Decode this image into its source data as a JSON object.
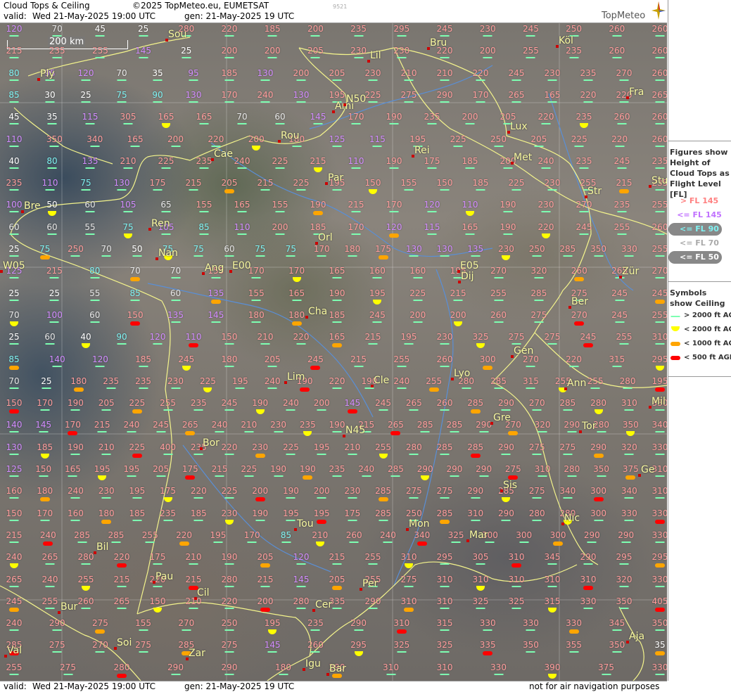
{
  "header": {
    "title": "Cloud Tops & Ceiling",
    "copyright": "©2025 TopMeteo.eu, EUMETSAT",
    "image_id": "9521",
    "valid_label": "valid:",
    "valid_time": "Wed  21-May-2025  19:00 UTC",
    "gen_time": "gen: 21-May-2025 19 UTC",
    "logo": "TopMeteo"
  },
  "footer": {
    "valid_label": "valid:",
    "valid_time": "Wed  21-May-2025  19:00 UTC",
    "gen_time": "gen: 21-May-2025 19 UTC",
    "disclaimer": "not for air navigation purposes"
  },
  "scale": "200 km",
  "legend": {
    "fl_title": "Figures show Height of Cloud Tops as Flight Level  [FL]",
    "fl_items": [
      "> FL 145",
      "<= FL 145",
      "<= FL 90",
      "<= FL 70",
      "<= FL 50"
    ],
    "sym_title": "Symbols show Ceiling",
    "sym_items": [
      "> 2000 ft AGL",
      "< 2000 ft AGL",
      "< 1000 ft AGL",
      "< 500 ft AGL"
    ]
  },
  "cities": [
    "Sou",
    "Ply",
    "Köl",
    "Bru",
    "Lil",
    "Fra",
    "Ami",
    "N50",
    "Lux",
    "Rou",
    "Cae",
    "Rei",
    "Met",
    "Par",
    "Stu",
    "Str",
    "Bre",
    "Ren",
    "Orl",
    "Ang",
    "E00",
    "W05",
    "Nan",
    "Zür",
    "E05",
    "Dij",
    "Ber",
    "Cha",
    "Gen",
    "Lim",
    "Cle",
    "Lyo",
    "Ann",
    "Mil",
    "Bor",
    "N45",
    "Gre",
    "Tor",
    "Ge",
    "Sis",
    "Nic",
    "Tou",
    "Mon",
    "Mar",
    "Bil",
    "Pau",
    "Cil",
    "Per",
    "Bur",
    "Cer",
    "Soi",
    "Aja",
    "Val",
    "Zar",
    "Igu",
    "Bar"
  ],
  "cloud_tops": [
    [
      "120",
      "70",
      "45",
      "25",
      "280",
      "220",
      "185",
      "200",
      "235",
      "295",
      "245",
      "230",
      "245",
      "250",
      "260",
      "260"
    ],
    [
      "215",
      "235",
      "255",
      "145",
      "25",
      "200",
      "200",
      "205",
      "230",
      "230",
      "220",
      "200",
      "255",
      "235",
      "260",
      "260"
    ],
    [
      "80",
      "95",
      "120",
      "70",
      "35",
      "95",
      "185",
      "130",
      "200",
      "205",
      "230",
      "210",
      "210",
      "220",
      "245",
      "230",
      "235",
      "270",
      "260"
    ],
    [
      "85",
      "30",
      "25",
      "75",
      "90",
      "130",
      "170",
      "240",
      "130",
      "195",
      "225",
      "275",
      "290",
      "170",
      "265",
      "165",
      "220",
      "220",
      "265"
    ],
    [
      "45",
      "35",
      "115",
      "305",
      "165",
      "165",
      "70",
      "60",
      "145",
      "170",
      "190",
      "235",
      "200",
      "205",
      "220",
      "235",
      "260",
      "260"
    ],
    [
      "110",
      "350",
      "340",
      "165",
      "200",
      "220",
      "200",
      "180",
      "125",
      "115",
      "195",
      "225",
      "250",
      "205",
      "225",
      "220",
      "260"
    ],
    [
      "40",
      "80",
      "135",
      "210",
      "225",
      "235",
      "240",
      "225",
      "215",
      "110",
      "190",
      "175",
      "185",
      "200",
      "240",
      "235",
      "245",
      "235"
    ],
    [
      "235",
      "110",
      "75",
      "130",
      "175",
      "215",
      "205",
      "215",
      "225",
      "195",
      "150",
      "155",
      "150",
      "185",
      "225",
      "230",
      "255",
      "215",
      "235"
    ],
    [
      "100",
      "50",
      "60",
      "105",
      "65",
      "155",
      "165",
      "155",
      "190",
      "215",
      "170",
      "120",
      "110",
      "190",
      "230",
      "270",
      "235",
      "255"
    ],
    [
      "60",
      "60",
      "55",
      "75",
      "105",
      "85",
      "110",
      "200",
      "185",
      "170",
      "120",
      "115",
      "165",
      "190",
      "220",
      "245",
      "255",
      "260"
    ],
    [
      "25",
      "75",
      "250",
      "70",
      "50",
      "75",
      "75",
      "60",
      "75",
      "75",
      "170",
      "180",
      "175",
      "130",
      "130",
      "135",
      "230",
      "250",
      "285",
      "350",
      "330",
      "255"
    ],
    [
      "125",
      "215",
      "80",
      "70",
      "70",
      "155",
      "170",
      "170",
      "165",
      "160",
      "160",
      "195",
      "270",
      "320",
      "260",
      "265",
      "270"
    ],
    [
      "25",
      "25",
      "55",
      "85",
      "60",
      "135",
      "155",
      "165",
      "190",
      "195",
      "225",
      "215",
      "255",
      "285",
      "275",
      "245",
      "245"
    ],
    [
      "70",
      "100",
      "60",
      "150",
      "135",
      "145",
      "180",
      "180",
      "185",
      "245",
      "200",
      "200",
      "260",
      "275",
      "270",
      "245",
      "255"
    ],
    [
      "25",
      "60",
      "40",
      "90",
      "120",
      "110",
      "150",
      "210",
      "220",
      "165",
      "215",
      "195",
      "230",
      "325",
      "275",
      "275",
      "245",
      "255",
      "310"
    ],
    [
      "85",
      "140",
      "120",
      "185",
      "245",
      "180",
      "205",
      "245",
      "215",
      "255",
      "260",
      "300",
      "270",
      "220",
      "315",
      "295"
    ],
    [
      "70",
      "25",
      "180",
      "235",
      "235",
      "230",
      "225",
      "195",
      "240",
      "190",
      "220",
      "190",
      "240",
      "255",
      "280",
      "285",
      "315",
      "255",
      "255",
      "280",
      "195"
    ],
    [
      "150",
      "170",
      "190",
      "205",
      "225",
      "255",
      "235",
      "245",
      "190",
      "240",
      "200",
      "145",
      "245",
      "265",
      "260",
      "285",
      "290",
      "270",
      "285",
      "280",
      "310",
      "330"
    ],
    [
      "140",
      "145",
      "170",
      "215",
      "240",
      "245",
      "265",
      "240",
      "210",
      "230",
      "235",
      "190",
      "215",
      "265",
      "285",
      "285",
      "290",
      "270",
      "320",
      "290",
      "280",
      "350",
      "340"
    ],
    [
      "130",
      "185",
      "190",
      "210",
      "225",
      "400",
      "235",
      "220",
      "230",
      "225",
      "195",
      "210",
      "255",
      "280",
      "285",
      "285",
      "290",
      "275",
      "275",
      "290",
      "320",
      "330"
    ],
    [
      "125",
      "150",
      "165",
      "195",
      "195",
      "205",
      "175",
      "215",
      "225",
      "190",
      "190",
      "235",
      "240",
      "285",
      "290",
      "290",
      "290",
      "275",
      "310",
      "280",
      "350",
      "375",
      "310"
    ],
    [
      "160",
      "180",
      "240",
      "230",
      "195",
      "175",
      "220",
      "225",
      "200",
      "190",
      "200",
      "230",
      "285",
      "275",
      "275",
      "290",
      "285",
      "275",
      "340",
      "300",
      "340",
      "310"
    ],
    [
      "150",
      "170",
      "160",
      "180",
      "185",
      "235",
      "185",
      "230",
      "190",
      "195",
      "195",
      "175",
      "285",
      "250",
      "285",
      "310",
      "290",
      "280",
      "280",
      "300",
      "330",
      "330"
    ],
    [
      "215",
      "240",
      "285",
      "285",
      "255",
      "220",
      "195",
      "170",
      "85",
      "210",
      "260",
      "240",
      "340",
      "325",
      "300",
      "300",
      "300",
      "290",
      "290",
      "330"
    ],
    [
      "240",
      "265",
      "280",
      "220",
      "175",
      "210",
      "190",
      "205",
      "120",
      "215",
      "255",
      "310",
      "295",
      "305",
      "310",
      "345",
      "290",
      "295",
      "295"
    ],
    [
      "265",
      "240",
      "255",
      "215",
      "220",
      "215",
      "280",
      "215",
      "145",
      "205",
      "255",
      "275",
      "310",
      "310",
      "310",
      "310",
      "310",
      "320",
      "330"
    ],
    [
      "245",
      "255",
      "260",
      "265",
      "150",
      "210",
      "220",
      "200",
      "280",
      "335",
      "290",
      "310",
      "310",
      "325",
      "325",
      "315",
      "330",
      "350",
      "405"
    ],
    [
      "240",
      "290",
      "275",
      "155",
      "270",
      "250",
      "195",
      "235",
      "290",
      "310",
      "315",
      "330",
      "330",
      "330",
      "345",
      "350"
    ],
    [
      "285",
      "275",
      "270",
      "275",
      "285",
      "275",
      "145",
      "260",
      "295",
      "325",
      "325",
      "335",
      "350",
      "355",
      "350",
      "35"
    ],
    [
      "255",
      "275",
      "280",
      "290",
      "290",
      "180",
      "290",
      "310",
      "310",
      "330",
      "390",
      "375",
      "330"
    ]
  ]
}
